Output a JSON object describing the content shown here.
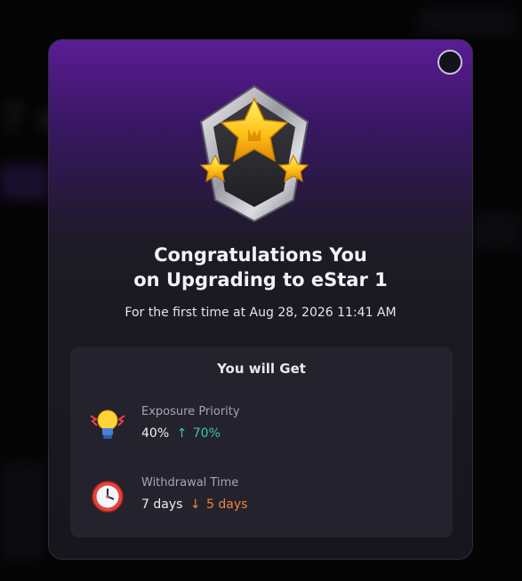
{
  "modal": {
    "title_line1": "Congratulations You",
    "title_line2": "on Upgrading to eStar 1",
    "subtitle": "For the first time at Aug 28, 2026 11:41 AM"
  },
  "benefits": {
    "heading": "You will Get",
    "items": [
      {
        "icon": "lightbulb-icon",
        "label": "Exposure Priority",
        "old_value": "40%",
        "arrow": "↑",
        "new_value": "70%"
      },
      {
        "icon": "clock-icon",
        "label": "Withdrawal Time",
        "old_value": "7 days",
        "arrow": "↓",
        "new_value": "5 days"
      }
    ]
  },
  "colors": {
    "accent_purple": "#5b1c94",
    "increase": "#34c9a2",
    "decrease": "#f0823a"
  }
}
